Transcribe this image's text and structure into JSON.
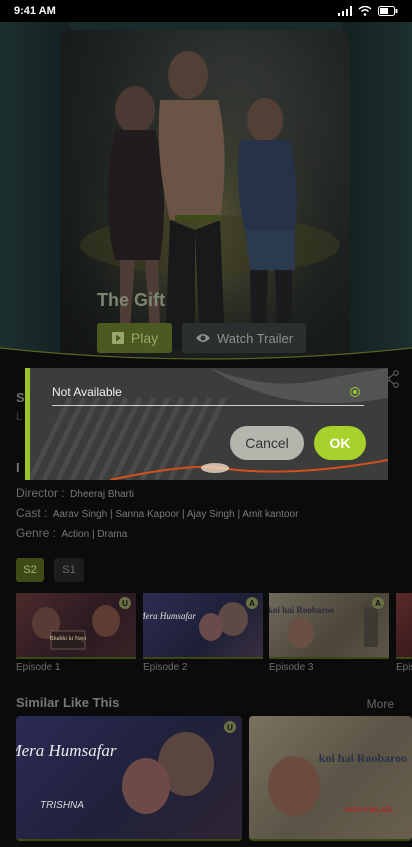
{
  "status": {
    "time": "9:41 AM"
  },
  "movie": {
    "title": "The Gift",
    "play_label": "Play",
    "trailer_label": "Watch Trailer"
  },
  "details": {
    "synopsis_heading": "S",
    "synopsis_text": "L e",
    "info_heading": "I",
    "director_label": "Director :",
    "director_value": "Dheeraj Bharti",
    "cast_label": "Cast :",
    "cast_value": "Aarav Singh | Sanna Kapoor | Ajay Singh | Amit kantoor",
    "genre_label": "Genre :",
    "genre_value": "Action  |  Drama"
  },
  "seasons": [
    "S2",
    "S1"
  ],
  "episodes": [
    {
      "label": "Episode 1",
      "badge": "U",
      "poster_text": "Bhabhi ki Nayi"
    },
    {
      "label": "Episode 2",
      "badge": "A",
      "poster_text": "Mera Humsafar"
    },
    {
      "label": "Episode 3",
      "badge": "A",
      "poster_text": "koi hai Roobaroo"
    },
    {
      "label": "Epis",
      "badge": "",
      "poster_text": ""
    }
  ],
  "similar": {
    "heading": "Similar Like This",
    "more_label": "More",
    "items": [
      {
        "badge": "U",
        "poster_title": "Mera Humsafar",
        "poster_sub": "TRISHNA"
      },
      {
        "badge": "",
        "poster_title": "koi hai Roobaroo",
        "poster_sub": "MISS KHILADI"
      }
    ]
  },
  "dialog": {
    "option_label": "Not Available",
    "cancel_label": "Cancel",
    "ok_label": "OK"
  },
  "colors": {
    "accent": "#9bc627",
    "ok_button": "#a9d12b",
    "cancel_button": "#b5b5ad"
  }
}
